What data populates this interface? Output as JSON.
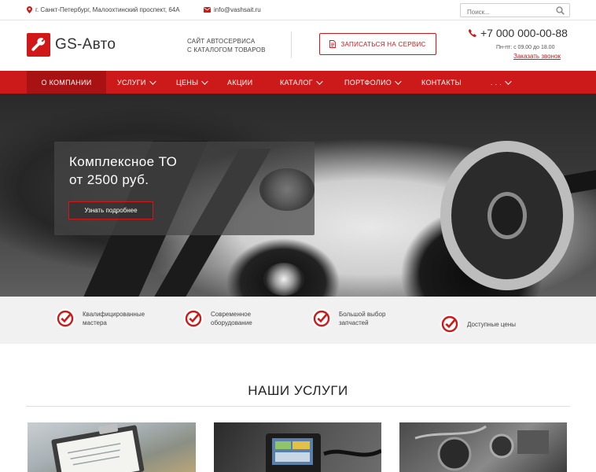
{
  "topbar": {
    "address": "г. Санкт-Петербург, Малоохтинский проспект, 64А",
    "email": "info@vashsait.ru",
    "search_placeholder": "Поиск..."
  },
  "header": {
    "logo_text": "GS-Авто",
    "tagline_line1": "САЙТ АВТОСЕРВИСА",
    "tagline_line2": "С КАТАЛОГОМ ТОВАРОВ",
    "cta_label": "ЗАПИСАТЬСЯ НА СЕРВИС",
    "phone": "+7 000 000-00-88",
    "hours": "Пн-пт: с 09.00 до 18.00",
    "callback_label": "Заказать звонок"
  },
  "nav": {
    "items": [
      {
        "label": "О КОМПАНИИ",
        "active": true
      },
      {
        "label": "УСЛУГИ",
        "dropdown": true
      },
      {
        "label": "ЦЕНЫ",
        "dropdown": true
      },
      {
        "label": "АКЦИИ"
      },
      {
        "label": "КАТАЛОГ",
        "dropdown": true
      },
      {
        "label": "ПОРТФОЛИО",
        "dropdown": true
      },
      {
        "label": "КОНТАКТЫ"
      },
      {
        "label": ". . .",
        "dropdown": true
      }
    ]
  },
  "hero": {
    "title_line1": "Комплексное ТО",
    "title_line2": "от 2500 руб.",
    "button_label": "Узнать подробнее"
  },
  "features": [
    {
      "line1": "Квалифицированные",
      "line2": "мастера"
    },
    {
      "line1": "Современное",
      "line2": "оборудование"
    },
    {
      "line1": "Большой выбор",
      "line2": "запчастей"
    },
    {
      "line1": "Доступные цены",
      "line2": ""
    }
  ],
  "services": {
    "title": "НАШИ УСЛУГИ"
  },
  "colors": {
    "accent": "#cc1a1a",
    "accent_dark": "#a81212",
    "features_bg": "#f1f1f1"
  }
}
